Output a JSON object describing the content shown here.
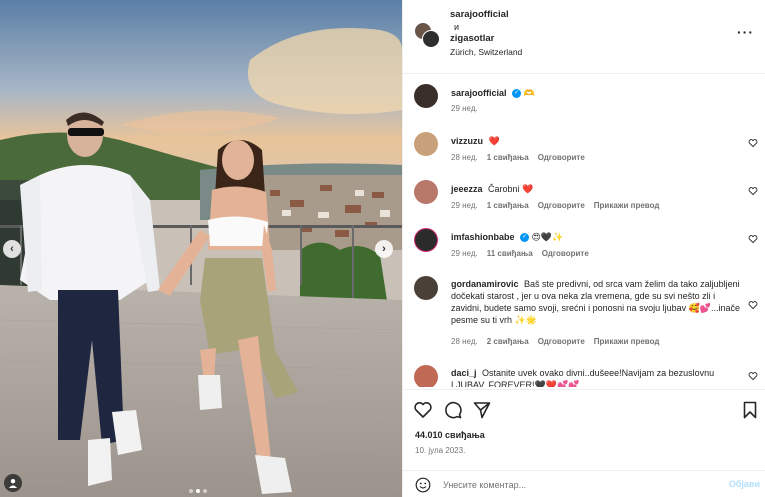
{
  "colors": {
    "accent": "#0095f6",
    "heart": "#ed4956",
    "muted": "#737373",
    "text": "#262626"
  },
  "photo": {
    "description_icon": "carousel-photo",
    "prev_icon": "chevron-left-icon",
    "next_icon": "chevron-right-icon",
    "carousel_dots": 3,
    "active_dot": 2
  },
  "header": {
    "user1": "sarajoofficial",
    "and": "и",
    "user2": "zigasotlar",
    "location": "Zürich, Switzerland",
    "more_icon": "more-horizontal-icon"
  },
  "caption": {
    "user": "sarajoofficial",
    "text": "🫶",
    "time": "29 нед."
  },
  "comments": [
    {
      "user": "vizzuzu",
      "text": "❤️",
      "time": "28 нед.",
      "likes": "1 свиђања",
      "reply": "Одговорите",
      "extra": ""
    },
    {
      "user": "jeeezza",
      "text": "Čarobni ❤️",
      "time": "29 нед.",
      "likes": "1 свиђања",
      "reply": "Одговорите",
      "extra": "Прикажи превод"
    },
    {
      "user": "imfashionbabe",
      "text": "😍🖤✨",
      "time": "29 нед.",
      "likes": "11 свиђања",
      "reply": "Одговорите",
      "extra": ""
    },
    {
      "user": "gordanamirovic",
      "text": "Baš ste predivni, od srca vam želim da tako zaljubljeni dočekati starost , jer u ova neka zla vremena, gde su svi nešto zli i zavidni, budete samo svoji, srećni i ponosni na svoju ljubav 🥰💕...inače pesme su ti vrh ✨🌟",
      "time": "28 нед.",
      "likes": "2 свиђања",
      "reply": "Одговорите",
      "extra": "Прикажи превод"
    },
    {
      "user": "daci_j",
      "text": "Ostanite uvek ovako divni..dušeee!Navijam za bezuslovnu LJUBAV, FOREVER!🖤❤️💕💕",
      "time": "",
      "likes": "",
      "reply": "",
      "extra": ""
    }
  ],
  "actions": {
    "like_icon": "heart-icon",
    "comment_icon": "comment-icon",
    "share_icon": "share-icon",
    "save_icon": "bookmark-icon"
  },
  "likes_count": "44.010 свиђања",
  "post_date": "10. јула 2023.",
  "add_comment": {
    "placeholder": "Унесите коментар...",
    "post_label": "Објави",
    "emoji_icon": "emoji-icon"
  }
}
